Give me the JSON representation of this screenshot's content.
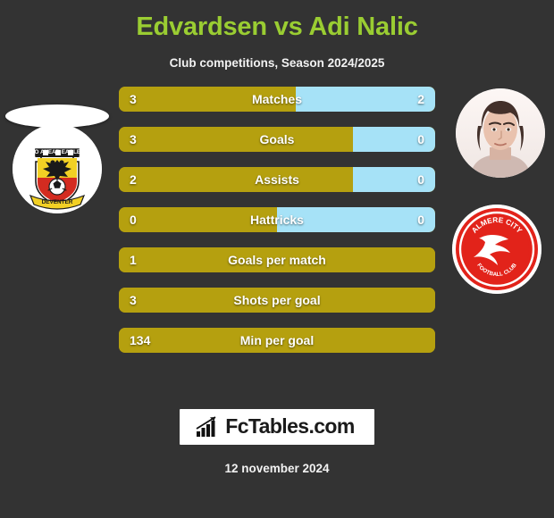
{
  "header": {
    "title": "Edvardsen vs Adi Nalic",
    "subtitle": "Club competitions, Season 2024/2025",
    "title_color": "#9acd32"
  },
  "players": {
    "left": {
      "name": "Edvardsen",
      "photo": "missing-player-photo",
      "club_crest": "go-ahead-eagles-deventer-crest",
      "club_name": "GO AHEAD EAGLES",
      "club_city": "DEVENTER"
    },
    "right": {
      "name": "Adi Nalic",
      "photo": "player-portrait",
      "club_crest": "almere-city-football-club-crest",
      "club_name": "ALMERE CITY",
      "club_sub": "FOOTBALL CLUB"
    }
  },
  "colors": {
    "background": "#333333",
    "left_bar": "#b5a00f",
    "right_bar": "#a6e2f7",
    "accent": "#9acd32"
  },
  "chart_data": {
    "type": "bar",
    "title": "Edvardsen vs Adi Nalic",
    "subtitle": "Club competitions, Season 2024/2025",
    "series": [
      {
        "name": "Edvardsen",
        "color": "#b5a00f",
        "values": [
          "3",
          "3",
          "2",
          "0",
          "1",
          "3",
          "134"
        ]
      },
      {
        "name": "Adi Nalic",
        "color": "#a6e2f7",
        "values": [
          "2",
          "0",
          "0",
          "0",
          null,
          null,
          null
        ]
      }
    ],
    "categories": [
      "Matches",
      "Goals",
      "Assists",
      "Hattricks",
      "Goals per match",
      "Shots per goal",
      "Min per goal"
    ],
    "rows": [
      {
        "label": "Matches",
        "left": "3",
        "right": "2",
        "left_pct": 56,
        "split": true
      },
      {
        "label": "Goals",
        "left": "3",
        "right": "0",
        "left_pct": 74,
        "split": true
      },
      {
        "label": "Assists",
        "left": "2",
        "right": "0",
        "left_pct": 74,
        "split": true
      },
      {
        "label": "Hattricks",
        "left": "0",
        "right": "0",
        "left_pct": 50,
        "split": true
      },
      {
        "label": "Goals per match",
        "left": "1",
        "right": "",
        "left_pct": 100,
        "split": false
      },
      {
        "label": "Shots per goal",
        "left": "3",
        "right": "",
        "left_pct": 100,
        "split": false
      },
      {
        "label": "Min per goal",
        "left": "134",
        "right": "",
        "left_pct": 100,
        "split": false
      }
    ]
  },
  "footer": {
    "logo_text": "FcTables.com",
    "logo_icon": "bar-chart-growth-icon",
    "date": "12 november 2024"
  }
}
